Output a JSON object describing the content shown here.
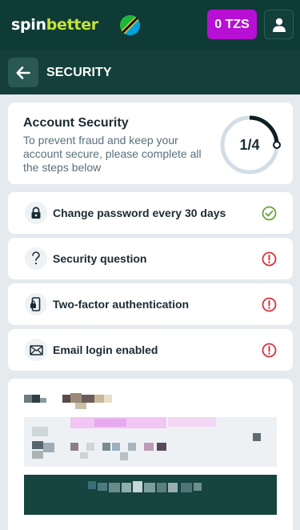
{
  "header": {
    "logo_part1": "spin",
    "logo_part2": "better",
    "balance_label": "0 TZS"
  },
  "subheader": {
    "title": "SECURITY"
  },
  "account_security": {
    "title": "Account Security",
    "description": "To prevent fraud and keep your account secure, please complete all the steps below",
    "progress_label": "1/4",
    "progress_completed": 1,
    "progress_total": 4
  },
  "steps": [
    {
      "label": "Change password every 30 days",
      "icon": "lock-icon",
      "status": "completed"
    },
    {
      "label": "Security question",
      "icon": "question-icon",
      "status": "incomplete"
    },
    {
      "label": "Two-factor authentication",
      "icon": "phone-lock-icon",
      "status": "incomplete"
    },
    {
      "label": "Email login enabled",
      "icon": "envelope-icon",
      "status": "incomplete"
    }
  ],
  "colors": {
    "header_bg": "#0e3b36",
    "brand_green": "#c4e23a",
    "balance_purple": "#b80fd4",
    "success": "#6aa33a",
    "warning": "#d9303a"
  }
}
